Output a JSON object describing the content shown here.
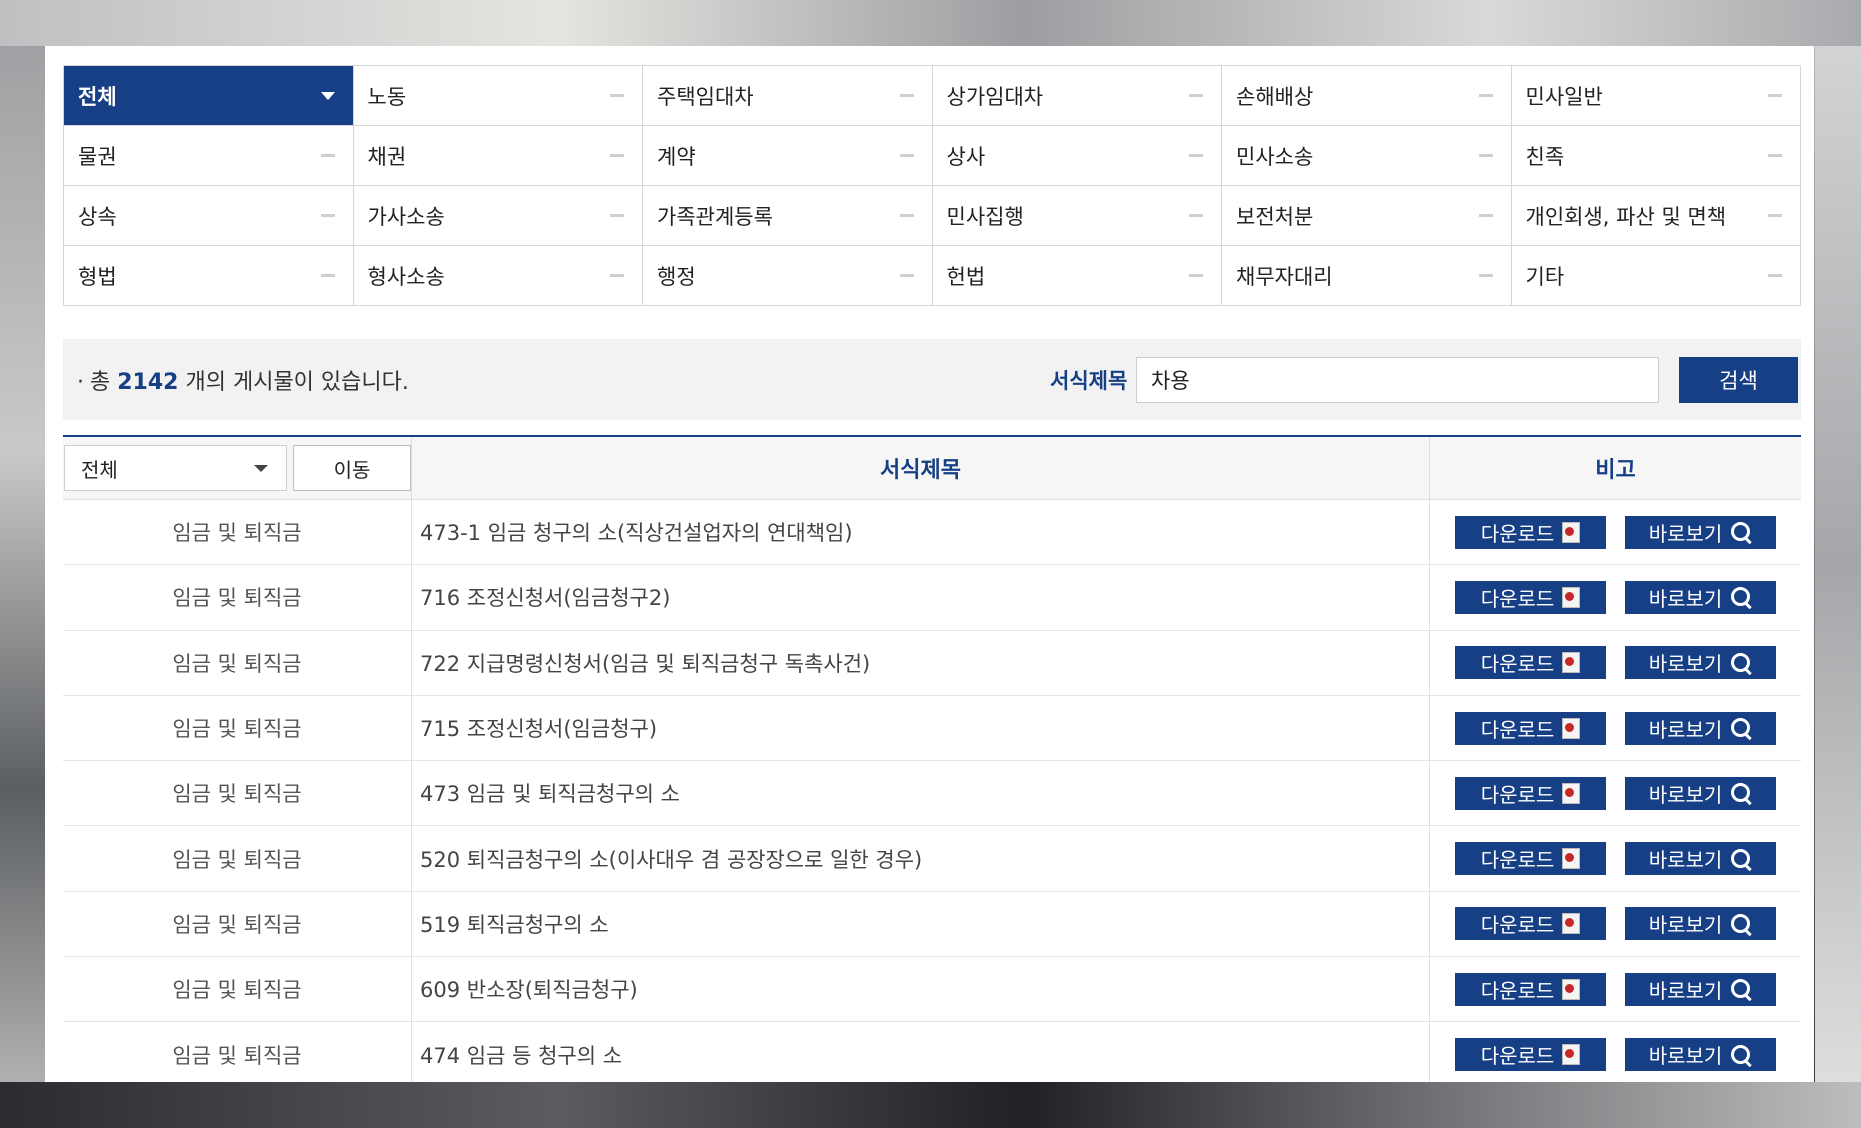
{
  "categories": [
    {
      "label": "전체",
      "active": true
    },
    {
      "label": "노동"
    },
    {
      "label": "주택임대차"
    },
    {
      "label": "상가임대차"
    },
    {
      "label": "손해배상"
    },
    {
      "label": "민사일반"
    },
    {
      "label": "물권"
    },
    {
      "label": "채권"
    },
    {
      "label": "계약"
    },
    {
      "label": "상사"
    },
    {
      "label": "민사소송"
    },
    {
      "label": "친족"
    },
    {
      "label": "상속"
    },
    {
      "label": "가사소송"
    },
    {
      "label": "가족관계등록"
    },
    {
      "label": "민사집행"
    },
    {
      "label": "보전처분"
    },
    {
      "label": "개인회생, 파산 및 면책"
    },
    {
      "label": "형법"
    },
    {
      "label": "형사소송"
    },
    {
      "label": "행정"
    },
    {
      "label": "헌법"
    },
    {
      "label": "채무자대리"
    },
    {
      "label": "기타"
    }
  ],
  "summary": {
    "bullet": "·",
    "prefix": "총",
    "count": "2142",
    "suffix": "개의 게시물이 있습니다."
  },
  "search": {
    "label": "서식제목",
    "value": "차용",
    "button": "검색"
  },
  "table": {
    "filter_value": "전체",
    "move_button": "이동",
    "col_title": "서식제목",
    "col_note": "비고",
    "download_label": "다운로드",
    "view_label": "바로보기",
    "rows": [
      {
        "category": "임금 및 퇴직금",
        "title": "473-1 임금 청구의 소(직상건설업자의 연대책임)"
      },
      {
        "category": "임금 및 퇴직금",
        "title": "716 조정신청서(임금청구2)"
      },
      {
        "category": "임금 및 퇴직금",
        "title": "722 지급명령신청서(임금 및 퇴직금청구 독촉사건)"
      },
      {
        "category": "임금 및 퇴직금",
        "title": "715 조정신청서(임금청구)"
      },
      {
        "category": "임금 및 퇴직금",
        "title": "473 임금 및 퇴직금청구의 소"
      },
      {
        "category": "임금 및 퇴직금",
        "title": "520 퇴직금청구의 소(이사대우 겸 공장장으로 일한 경우)"
      },
      {
        "category": "임금 및 퇴직금",
        "title": "519 퇴직금청구의 소"
      },
      {
        "category": "임금 및 퇴직금",
        "title": "609 반소장(퇴직금청구)"
      },
      {
        "category": "임금 및 퇴직금",
        "title": "474 임금 등 청구의 소"
      }
    ]
  },
  "colors": {
    "accent": "#173f85"
  }
}
